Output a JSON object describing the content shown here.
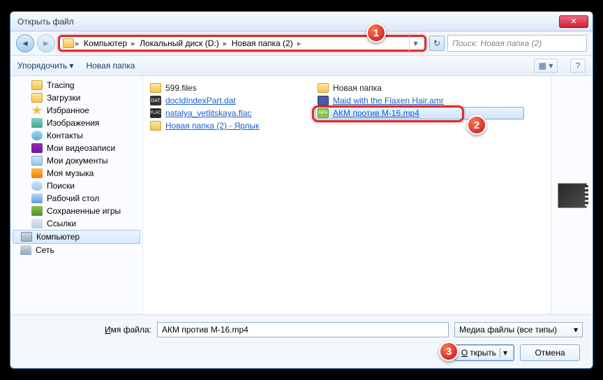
{
  "title": "Открыть файл",
  "breadcrumb": [
    "Компьютер",
    "Локальный диск (D:)",
    "Новая папка (2)"
  ],
  "search_placeholder": "Поиск: Новая папка (2)",
  "toolbar": {
    "organize": "Упорядочить",
    "newfolder": "Новая папка"
  },
  "sidebar": [
    {
      "label": "Tracing",
      "ico": "folder",
      "lvl": 1
    },
    {
      "label": "Загрузки",
      "ico": "folder",
      "lvl": 1
    },
    {
      "label": "Избранное",
      "ico": "star",
      "lvl": 1
    },
    {
      "label": "Изображения",
      "ico": "img",
      "lvl": 1
    },
    {
      "label": "Контакты",
      "ico": "user",
      "lvl": 1
    },
    {
      "label": "Мои видеозаписи",
      "ico": "vid",
      "lvl": 1
    },
    {
      "label": "Мои документы",
      "ico": "doc",
      "lvl": 1
    },
    {
      "label": "Моя музыка",
      "ico": "music",
      "lvl": 1
    },
    {
      "label": "Поиски",
      "ico": "search",
      "lvl": 1
    },
    {
      "label": "Рабочий стол",
      "ico": "desk",
      "lvl": 1
    },
    {
      "label": "Сохраненные игры",
      "ico": "game",
      "lvl": 1
    },
    {
      "label": "Ссылки",
      "ico": "link",
      "lvl": 1
    },
    {
      "label": "Компьютер",
      "ico": "comp",
      "lvl": 0,
      "sel": true
    },
    {
      "label": "Сеть",
      "ico": "net",
      "lvl": 0
    }
  ],
  "files_col1": [
    {
      "label": "599.files",
      "ico": "folder",
      "plain": true
    },
    {
      "label": "docIdIndexPart.dat",
      "ico": "dat",
      "txt": "DAT"
    },
    {
      "label": "natalya_vetlitskaya.flac",
      "ico": "flac",
      "txt": "FLAC"
    },
    {
      "label": "Новая папка (2) - Ярлык",
      "ico": "folder"
    }
  ],
  "files_col2": [
    {
      "label": "Новая папка",
      "ico": "folder",
      "plain": true
    },
    {
      "label": "Maid with the Flaxen Hair.amr",
      "ico": "amr"
    },
    {
      "label": "АКМ против М-16.mp4",
      "ico": "mp4",
      "txt": "MP4",
      "sel": true
    }
  ],
  "filename_label": "Имя файла:",
  "filename_label_u": "И",
  "filename_value": "АКМ против М-16.mp4",
  "filter_label": "Медиа файлы (все типы)",
  "open_label": "Открыть",
  "open_label_u": "О",
  "cancel_label": "Отмена",
  "callouts": {
    "1": "1",
    "2": "2",
    "3": "3"
  }
}
